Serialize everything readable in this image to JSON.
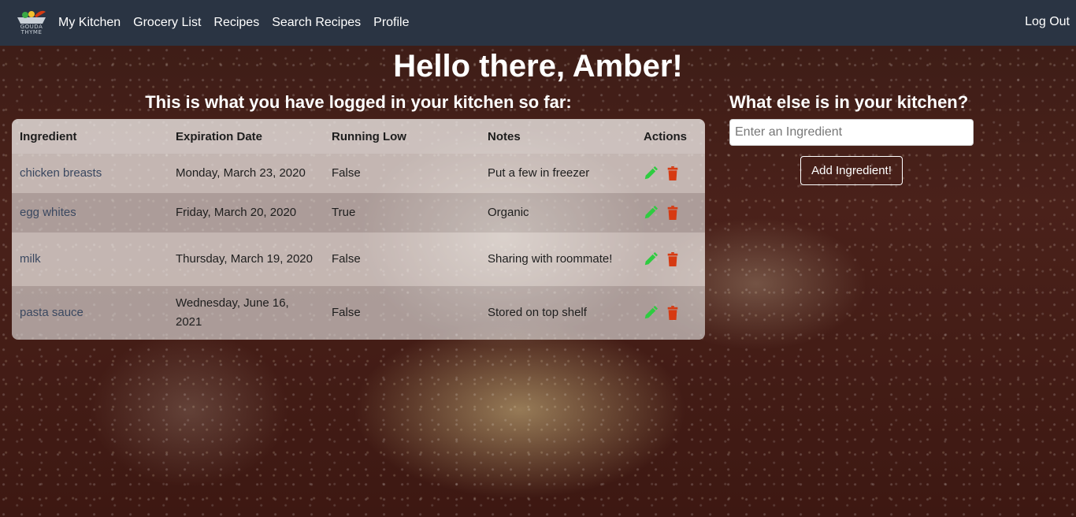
{
  "nav": {
    "logo_text_1": "GOUDA",
    "logo_text_2": "THYME",
    "links": [
      "My Kitchen",
      "Grocery List",
      "Recipes",
      "Search Recipes",
      "Profile"
    ],
    "logout": "Log Out"
  },
  "greeting": "Hello there, Amber!",
  "kitchen_heading": "This is what you have logged in your kitchen so far:",
  "add_heading": "What else is in your kitchen?",
  "add_input_placeholder": "Enter an Ingredient",
  "add_button": "Add Ingredient!",
  "table": {
    "headers": [
      "Ingredient",
      "Expiration Date",
      "Running Low",
      "Notes",
      "Actions"
    ],
    "rows": [
      {
        "ingredient": "chicken breasts",
        "expiration": "Monday, March 23, 2020",
        "running_low": "False",
        "notes": "Put a few in freezer"
      },
      {
        "ingredient": "egg whites",
        "expiration": "Friday, March 20, 2020",
        "running_low": "True",
        "notes": "Organic"
      },
      {
        "ingredient": "milk",
        "expiration": "Thursday, March 19, 2020",
        "running_low": "False",
        "notes": "Sharing with roommate!"
      },
      {
        "ingredient": "pasta sauce",
        "expiration": "Wednesday, June 16, 2021",
        "running_low": "False",
        "notes": "Stored on top shelf"
      }
    ]
  },
  "icons": {
    "edit": "pencil-icon",
    "delete": "trash-icon"
  },
  "colors": {
    "navbar": "#2a3443",
    "edit_icon": "#2ecc40",
    "delete_icon": "#d63a12"
  }
}
